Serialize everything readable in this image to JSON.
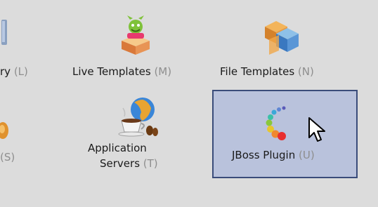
{
  "items": [
    {
      "label": "ry",
      "mnemonic": "(L)",
      "icon": "partial-icon"
    },
    {
      "label": "Live Templates",
      "mnemonic": "(M)",
      "icon": "live-templates-icon"
    },
    {
      "label": "File Templates",
      "mnemonic": "(N)",
      "icon": "file-templates-icon"
    },
    {
      "label": "",
      "mnemonic": "(S)",
      "icon": "partial-icon"
    },
    {
      "label_line1": "Application",
      "label_line2": "Servers",
      "mnemonic": "(T)",
      "icon": "application-servers-icon"
    },
    {
      "label": "JBoss Plugin",
      "mnemonic": "(U)",
      "icon": "jboss-plugin-icon",
      "selected": true
    }
  ],
  "colors": {
    "background": "#dcdcdc",
    "selection_fill": "#b9c2dc",
    "selection_border": "#3a4c7a",
    "mnemonic": "#8e8e8e"
  }
}
